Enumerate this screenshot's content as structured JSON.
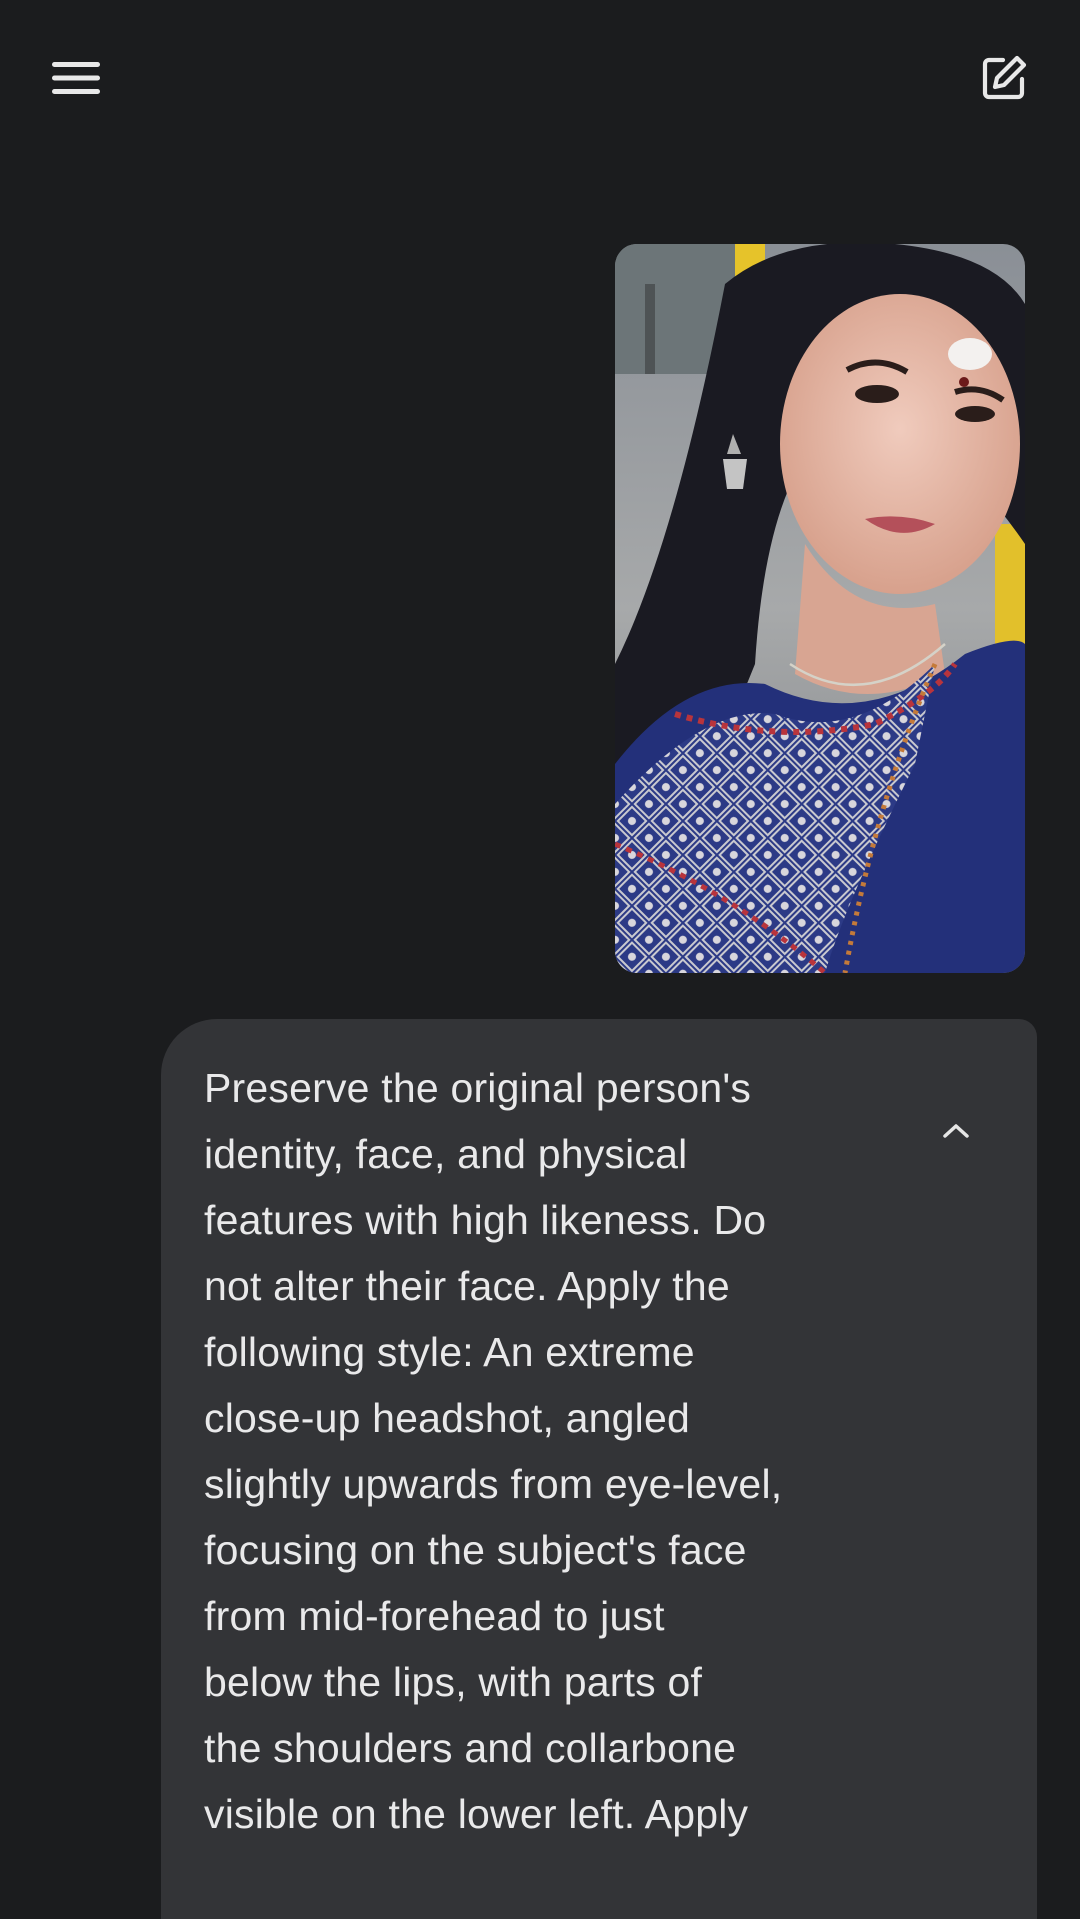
{
  "header": {
    "menu_icon": "menu-icon",
    "new_chat_icon": "edit-square-icon"
  },
  "conversation": {
    "user_image": {
      "description_icon": "uploaded-photo"
    },
    "user_message": {
      "text": "Preserve the original person's\nidentity, face, and physical\nfeatures with high likeness. Do\nnot alter their face. Apply the\nfollowing style: An extreme\nclose-up headshot, angled\nslightly upwards from eye-level,\nfocusing on the subject's face\nfrom mid-forehead to just\nbelow the lips, with parts of\nthe shoulders and collarbone\nvisible on the lower left. Apply",
      "collapse_icon": "chevron-up-icon"
    }
  },
  "colors": {
    "background": "#1b1c1e",
    "bubble": "#333437",
    "text": "#e9e9ea"
  }
}
